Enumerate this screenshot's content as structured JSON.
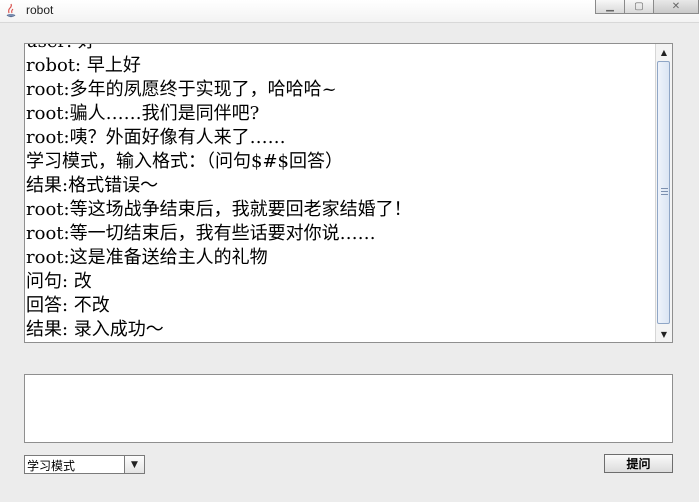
{
  "window": {
    "title": "robot",
    "minimize_icon": "minimize-icon",
    "maximize_icon": "maximize-icon",
    "close_icon": "close-icon"
  },
  "chat": {
    "lines": [
      "user: 好",
      "robot: 早上好",
      "root:多年的夙愿终于实现了，哈哈哈~",
      "root:骗人……我们是同伴吧?",
      "root:咦？外面好像有人来了……",
      "学习模式，输入格式：（问句$#$回答）",
      "结果:格式错误～",
      "root:等这场战争结束后，我就要回老家结婚了！",
      "root:等一切结束后，我有些话要对你说……",
      "root:这是准备送给主人的礼物",
      "问句: 改",
      "回答: 不改",
      "结果: 录入成功～"
    ]
  },
  "input": {
    "value": ""
  },
  "mode_select": {
    "selected": "学习模式"
  },
  "submit_button": {
    "label": "提问"
  }
}
